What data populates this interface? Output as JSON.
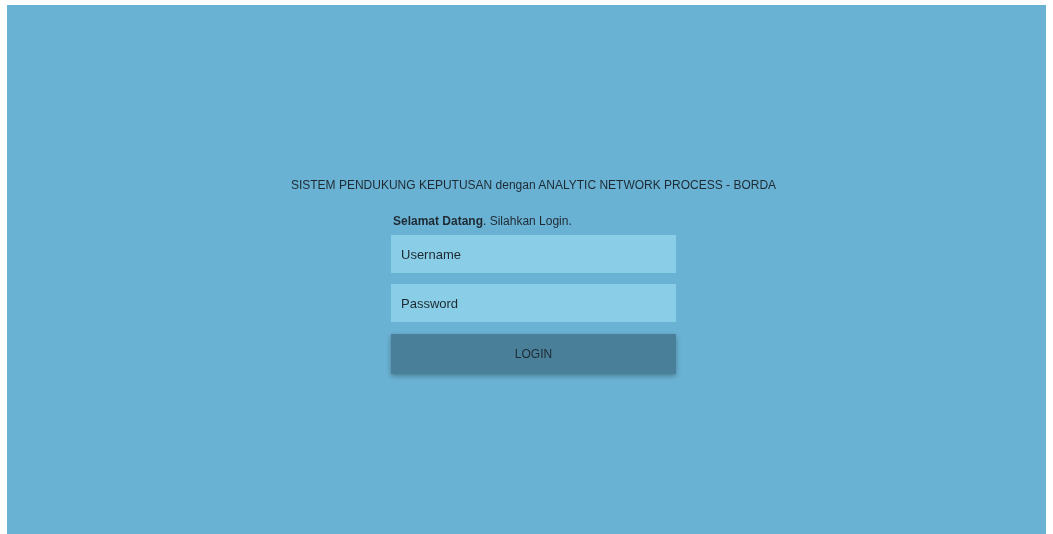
{
  "title": "SISTEM PENDUKUNG KEPUTUSAN dengan ANALYTIC NETWORK PROCESS - BORDA",
  "greeting": "**Selamat Datang**. Silahkan Login.",
  "fields": [
    {
      "placeholder": "Username"
    },
    {
      "placeholder": "Password"
    }
  ],
  "button": "LOGIN"
}
